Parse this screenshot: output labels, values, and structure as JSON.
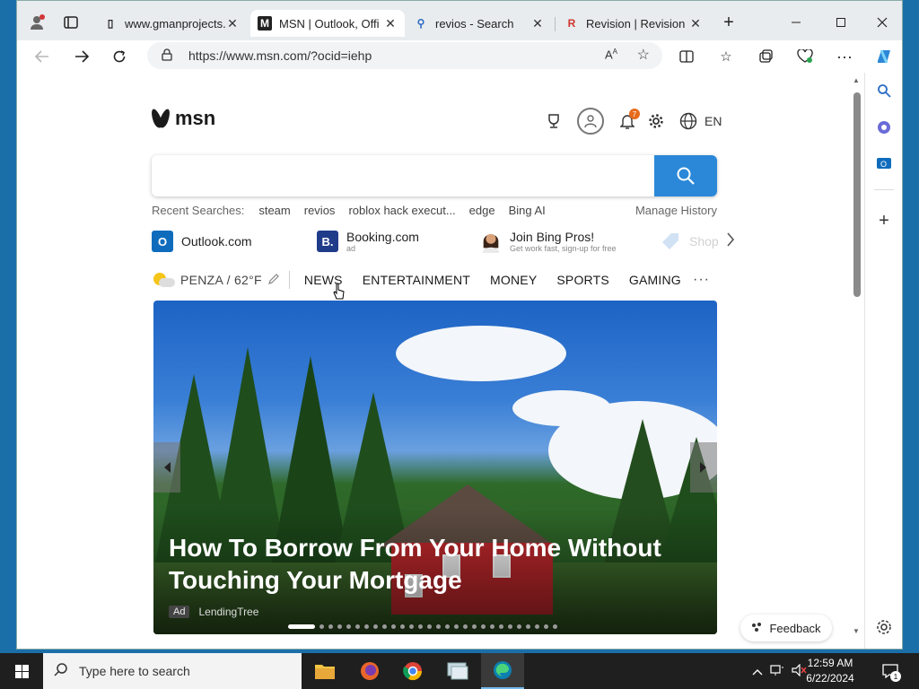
{
  "browser": {
    "tabs": [
      {
        "title": "www.gmanprojects.",
        "favicon": "page-icon",
        "active": false
      },
      {
        "title": "MSN | Outlook, Offi",
        "favicon": "msn-icon",
        "active": true
      },
      {
        "title": "revios - Search",
        "favicon": "search-icon",
        "active": false
      },
      {
        "title": "Revision | Revision",
        "favicon": "revision-icon",
        "active": false
      }
    ],
    "new_tab_glyph": "+",
    "tab_close_glyph": "✕",
    "url": "https://www.msn.com/?ocid=iehp",
    "read_aloud_label": "Ạʸ"
  },
  "msn": {
    "logo_text": "msn",
    "language": "EN",
    "notification_count": "7",
    "search": {
      "placeholder": ""
    },
    "recent_label": "Recent Searches:",
    "recent_searches": [
      "steam",
      "revios",
      "roblox hack execut...",
      "edge",
      "Bing AI"
    ],
    "manage_history": "Manage History",
    "quick_links": [
      {
        "title": "Outlook.com",
        "sub": "",
        "icon_color": "#0f6cbd",
        "icon_text": "O"
      },
      {
        "title": "Booking.com",
        "sub": "ad",
        "icon_color": "#1f3c8a",
        "icon_text": "B."
      },
      {
        "title": "Join Bing Pros!",
        "sub": "Get work fast, sign-up for free",
        "icon_color": "#c47e3a",
        "icon_text": ""
      },
      {
        "title": "Shop",
        "sub": "",
        "icon_color": "#a9c6e8",
        "icon_text": ""
      }
    ],
    "weather": {
      "location": "PENZA / 62°F"
    },
    "categories": [
      "NEWS",
      "ENTERTAINMENT",
      "MONEY",
      "SPORTS",
      "GAMING"
    ],
    "more_glyph": "···",
    "hero": {
      "title": "How To Borrow From Your Home Without Touching Your Mortgage",
      "ad_label": "Ad",
      "source": "LendingTree",
      "slide_count": 28,
      "active_slide": 1
    },
    "feedback_label": "Feedback"
  },
  "taskbar": {
    "search_placeholder": "Type here to search",
    "time": "12:59 AM",
    "date": "6/22/2024",
    "notifications": "1",
    "apps": [
      "file-explorer",
      "firefox",
      "chrome",
      "remote-desktop",
      "edge"
    ]
  }
}
